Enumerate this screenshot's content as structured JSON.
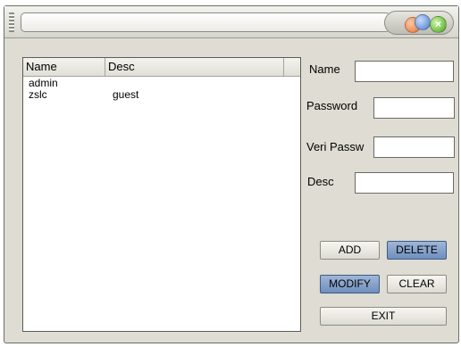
{
  "window": {
    "title": "",
    "close_glyph": "×"
  },
  "table": {
    "columns": [
      "Name",
      "Desc"
    ],
    "rows": [
      {
        "name": "admin",
        "desc": ""
      },
      {
        "name": "zslc",
        "desc": "guest"
      }
    ]
  },
  "form": {
    "name_label": "Name",
    "password_label": "Password",
    "verify_label": "Veri Passw",
    "desc_label": "Desc",
    "name_value": "",
    "password_value": "",
    "verify_value": "",
    "desc_value": ""
  },
  "buttons": {
    "add": "ADD",
    "delete": "DELETE",
    "modify": "MODIFY",
    "clear": "CLEAR",
    "exit": "EXIT"
  },
  "colors": {
    "window_bg": "#dedcd3",
    "active_button": "#7f9cc8",
    "close_button": "#4aa51e",
    "minimize_button": "#e2703a",
    "maximize_button": "#4d79c8"
  }
}
